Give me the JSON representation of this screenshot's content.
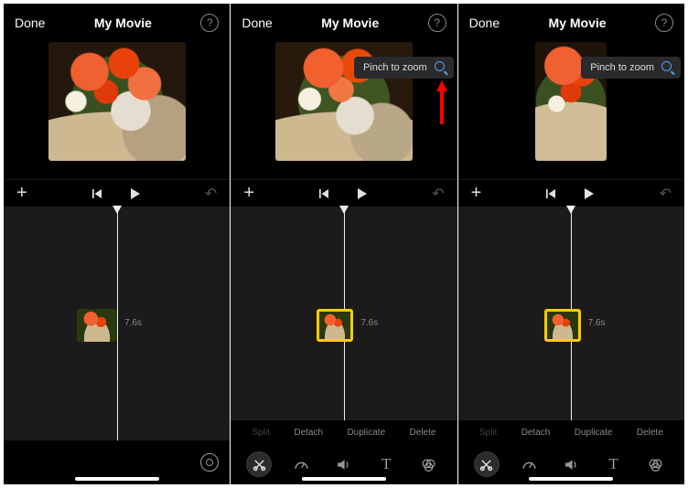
{
  "header": {
    "done_label": "Done",
    "title": "My Movie",
    "help_label": "?"
  },
  "pinch_tip": {
    "label": "Pinch to zoom"
  },
  "clip": {
    "duration": "7.6s"
  },
  "actions": {
    "split": "Split",
    "detach": "Detach",
    "duplicate": "Duplicate",
    "delete": "Delete"
  },
  "tools": {
    "cut": "cut-icon",
    "speed": "speed-icon",
    "volume": "volume-icon",
    "text": "text-icon",
    "filter": "filter-icon"
  }
}
